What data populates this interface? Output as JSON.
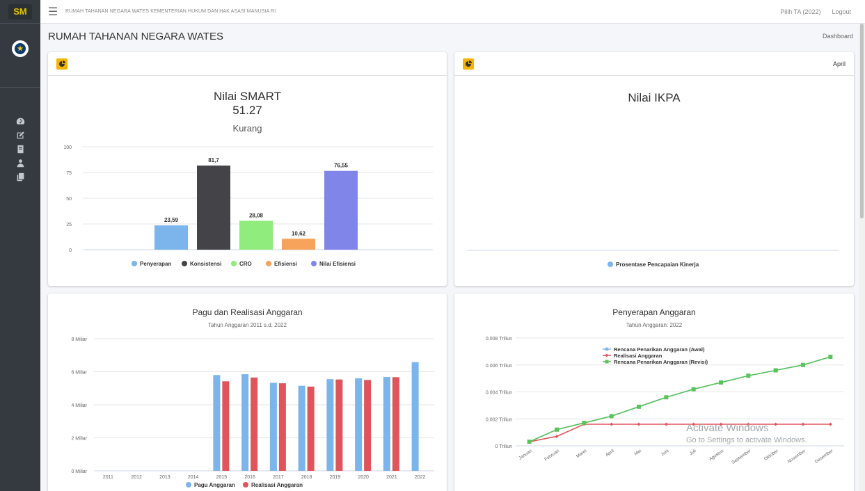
{
  "topbar": {
    "title": "RUMAH TAHANAN NEGARA WATES KEMENTERIAN HUKUM DAN HAK ASASI MANUSIA RI",
    "fiscal_year": "Pilih TA (2022)",
    "logout": "Logout",
    "menu_icon": "hamburger-icon"
  },
  "sidebar": {
    "brand": "SM",
    "items": [
      {
        "icon": "dashboard-icon"
      },
      {
        "icon": "edit-icon"
      },
      {
        "icon": "book-icon"
      },
      {
        "icon": "user-icon"
      },
      {
        "icon": "copy-icon"
      }
    ]
  },
  "content": {
    "page_title": "RUMAH TAHANAN NEGARA WATES",
    "breadcrumb": "Dashboard"
  },
  "smart": {
    "title": "Nilai SMART",
    "score": "51.27",
    "category": "Kurang"
  },
  "ikpa": {
    "title": "Nilai IKPA",
    "month": "April"
  },
  "pagu": {
    "title": "Pagu dan Realisasi Anggaran",
    "subtitle": "Tahun Anggaran 2011 s.d. 2022"
  },
  "penyerapan": {
    "title": "Penyerapan Anggaran",
    "subtitle": "Tahun Anggaran: 2022"
  },
  "watermark": {
    "line1": "Activate Windows",
    "line2": "Go to Settings to activate Windows."
  },
  "chart_data": [
    {
      "type": "bar",
      "categories": [
        "Penyerapan",
        "Konsistensi",
        "CRO",
        "Efisiensi",
        "Nilai Efisiensi"
      ],
      "values": [
        23.59,
        81.7,
        28.08,
        10.62,
        76.55
      ],
      "value_labels": [
        "23,59",
        "81,7",
        "28,08",
        "10,62",
        "76,55"
      ],
      "colors": [
        "#7cb5ec",
        "#434348",
        "#90ed7d",
        "#f7a35c",
        "#8085e9"
      ],
      "yticks": [
        "0",
        "25",
        "50",
        "75",
        "100"
      ],
      "ylim": [
        0,
        100
      ],
      "legend": "bottom"
    },
    {
      "type": "bar",
      "categories": [],
      "series": [
        {
          "name": "Prosentase Pencapaian Kinerja",
          "values": [],
          "color": "#7cb5ec"
        }
      ],
      "legend": "bottom"
    },
    {
      "type": "bar",
      "categories": [
        "2011",
        "2012",
        "2013",
        "2014",
        "2015",
        "2016",
        "2017",
        "2018",
        "2019",
        "2020",
        "2021",
        "2022"
      ],
      "series": [
        {
          "name": "Pagu Anggaran",
          "color": "#7cb5ec",
          "values": [
            0,
            0,
            0,
            0,
            5.8,
            5.85,
            5.33,
            5.15,
            5.55,
            5.6,
            5.68,
            6.58
          ]
        },
        {
          "name": "Realisasi Anggaran",
          "color": "#e0555c",
          "values": [
            0,
            0,
            0,
            0,
            5.42,
            5.65,
            5.3,
            5.1,
            5.53,
            5.5,
            5.67,
            null
          ]
        }
      ],
      "yticks": [
        "0 Miliar",
        "2 Miliar",
        "4 Miliar",
        "6 Miliar",
        "8 Miliar"
      ],
      "ylim": [
        0,
        8
      ],
      "legend": "bottom"
    },
    {
      "type": "line",
      "categories": [
        "Januari",
        "Februari",
        "Maret",
        "April",
        "Mei",
        "Juni",
        "Juli",
        "Agustus",
        "September",
        "Oktober",
        "November",
        "Desember"
      ],
      "series": [
        {
          "name": "Rencana Penarikan Anggaran (Awal)",
          "color": "#7cb5ec",
          "marker": "circle",
          "values": [
            0.0003,
            0.0012,
            0.0017,
            0.0022,
            0.0029,
            0.0036,
            0.0042,
            0.0047,
            0.0052,
            0.0056,
            0.006,
            0.0066
          ]
        },
        {
          "name": "Realisasi Anggaran",
          "color": "#e0555c",
          "marker": "diamond",
          "values": [
            0.0003,
            0.0007,
            0.0016,
            0.0016,
            0.0016,
            0.0016,
            0.0016,
            0.0016,
            0.0016,
            0.0016,
            0.0016,
            0.0016
          ]
        },
        {
          "name": "Rencana Penarikan Anggaran (Revisi)",
          "color": "#5ac45a",
          "marker": "square",
          "values": [
            0.0003,
            0.0012,
            0.0017,
            0.0022,
            0.0029,
            0.0036,
            0.0042,
            0.0047,
            0.0052,
            0.0056,
            0.006,
            0.0066
          ]
        }
      ],
      "yticks": [
        "0 Triliun",
        "0.002 Triliun",
        "0.004 Triliun",
        "0.006 Triliun",
        "0.008 Triliun"
      ],
      "ylim": [
        0,
        0.008
      ],
      "legend": "top-left"
    }
  ]
}
